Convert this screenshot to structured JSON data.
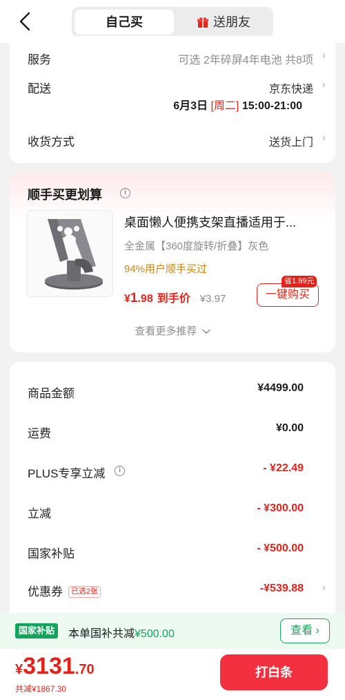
{
  "header": {
    "tab_self": "自己买",
    "tab_gift": "送朋友"
  },
  "services": {
    "service_label": "服务",
    "service_value": "可选 2年碎屏4年电池 共8项",
    "delivery_label": "配送",
    "delivery_value": "京东快递",
    "delivery_date": "6月3日",
    "delivery_weekday": "[周二]",
    "delivery_window": "15:00-21:00",
    "method_label": "收货方式",
    "method_value": "送货上门"
  },
  "addon": {
    "title": "顺手买更划算",
    "product_title": "桌面懒人便携支架直播适用于...",
    "product_spec": "全金属【360度旋转/折叠】灰色",
    "product_hint": "94%用户顺手买过",
    "price_currency": "¥",
    "price_int": "1",
    "price_dec": ".98",
    "price_tag": "到手价",
    "orig_price": "¥3.97",
    "save_badge": "省1.99元",
    "buy_label": "一键购买",
    "more_label": "查看更多推荐"
  },
  "amounts": [
    {
      "label": "商品金额",
      "value": "¥4499.00",
      "red": false
    },
    {
      "label": "运费",
      "value": "¥0.00",
      "red": false
    },
    {
      "label": "PLUS专享立减",
      "value": "- ¥22.49",
      "red": true
    },
    {
      "label": "立减",
      "value": "- ¥300.00",
      "red": true
    },
    {
      "label": "国家补贴",
      "value": "- ¥500.00",
      "red": true
    },
    {
      "label": "优惠券",
      "value": "-¥539.88",
      "red": true,
      "tag": "已选2张"
    }
  ],
  "subsidy": {
    "badge": "国家补贴",
    "text_prefix": "本单国补共减",
    "text_amount": "¥500.00",
    "button": "查看 ›"
  },
  "footer": {
    "currency": "¥",
    "total_int": "3131",
    "total_dec": ".70",
    "saved_text": "共减¥1867.30",
    "pay_label": "打白条"
  },
  "colors": {
    "accent_red": "#e2231a",
    "subsidy_green": "#12a45a",
    "pay_button": "#f3303f"
  }
}
